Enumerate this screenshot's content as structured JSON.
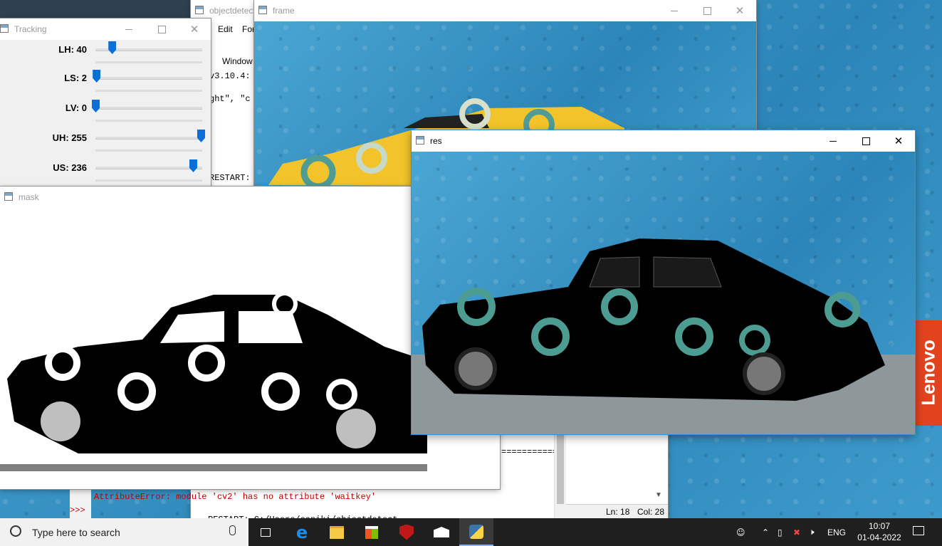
{
  "windows": {
    "idle": {
      "title": "objectdetect",
      "menu": [
        "Edit",
        "For"
      ],
      "menu2": "Window",
      "lines": [
        "v3.10.4:",
        "ght\", \"c",
        "RESTART:"
      ],
      "separator": "===========",
      "error": "AttributeError: module 'cv2' has no attribute 'waitkey'",
      "prompt": ">>>",
      "restart_line": "RESTART: C:/Users/saniki/objectdetect",
      "status_ln": "Ln: 18",
      "status_col": "Col: 28"
    },
    "frame": {
      "title": "frame"
    },
    "tracking": {
      "title": "Tracking",
      "sliders": [
        {
          "label": "LH: 40",
          "value": 40,
          "max": 255
        },
        {
          "label": "LS: 2",
          "value": 2,
          "max": 255
        },
        {
          "label": "LV: 0",
          "value": 0,
          "max": 255
        },
        {
          "label": "UH: 255",
          "value": 255,
          "max": 255
        },
        {
          "label": "US: 236",
          "value": 236,
          "max": 255
        }
      ]
    },
    "mask": {
      "title": "mask"
    },
    "res": {
      "title": "res"
    }
  },
  "desktop": {
    "brand": "Lenovo"
  },
  "taskbar": {
    "search_placeholder": "Type here to search",
    "language": "ENG",
    "time": "10:07",
    "date": "01-04-2022"
  }
}
